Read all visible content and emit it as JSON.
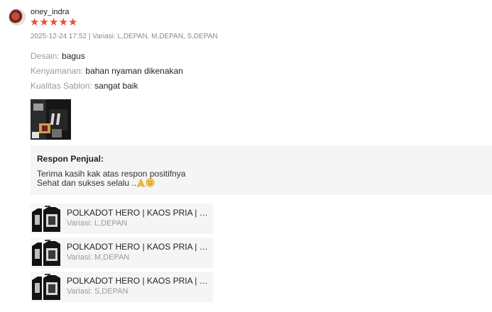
{
  "review": {
    "username": "oney_indra",
    "rating": 5,
    "meta": "2025-12-24 17:52 | Variasi: L,DEPAN, M,DEPAN, S,DEPAN",
    "attributes": [
      {
        "label": "Desain:",
        "value": "bagus"
      },
      {
        "label": "Kenyamanan:",
        "value": "bahan nyaman dikenakan"
      },
      {
        "label": "Kualitas Sablon:",
        "value": "sangat baik"
      }
    ]
  },
  "seller_response": {
    "title": "Respon Penjual:",
    "line1": "Terima kasih kak atas respon positifnya",
    "line2": "Sehat dan sukses selalu .."
  },
  "products": [
    {
      "title": "POLKADOT HERO | KAOS PRIA | KAOS PRIA",
      "variant": "Variasi: L,DEPAN"
    },
    {
      "title": "POLKADOT HERO | KAOS PRIA | KAOS PRIA",
      "variant": "Variasi: M,DEPAN"
    },
    {
      "title": "POLKADOT HERO | KAOS PRIA | KAOS PRIA",
      "variant": "Variasi: S,DEPAN"
    }
  ],
  "colors": {
    "star": "#ee4d2d",
    "panel": "#f5f5f5"
  }
}
